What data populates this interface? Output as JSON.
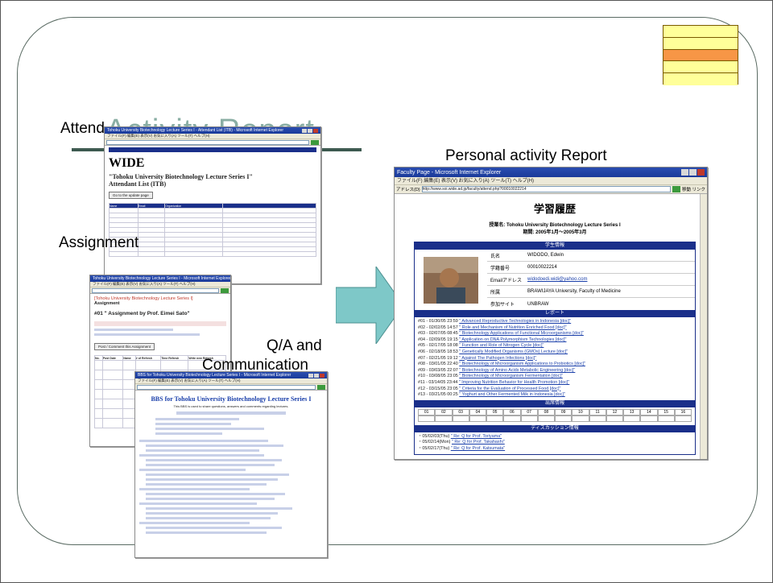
{
  "slide": {
    "title": "Activity Report",
    "labels": {
      "attend": "Attend",
      "assignment": "Assignment",
      "qa_line1": "Q/A and",
      "qa_line2": "Communication",
      "personal": "Personal activity Report"
    }
  },
  "colors": {
    "deco_yellow": "#ffff99",
    "deco_orange": "#f79646",
    "arrow": "#7ec8c8",
    "ie_title": "#1a3a9a"
  },
  "attend_window": {
    "titlebar": "Tohoku University Biotechnology Lecture Series I - Attendant List (ITB) - Microsoft Internet Explorer",
    "menubar": "ファイル(F)  編集(E)  表示(V)  お気に入り(A)  ツール(T)  ヘルプ(H)",
    "logo": "WIDE",
    "heading_line1": "\"Tohoku University Biotechnology Lecture Series I\"",
    "heading_line2": "Attendant List (ITB)",
    "update_button": "Go to the update page",
    "col_headers": [
      "Name",
      "Email",
      "Organization"
    ]
  },
  "assignment_window": {
    "titlebar": "Tohoku University Biotechnology Lecture Series I - Microsoft Internet Explorer",
    "heading": "[Tohoku University Biotechnology Lecture Series I]",
    "subheading": "Assignment",
    "assignment_title": "#01 \" Assignment by Prof. Eimei Sato\"",
    "post_button": "Post / Comment this Assignment",
    "col_headers": [
      "No.",
      "Post Date",
      "Name",
      "# of Refresh",
      "Time Refresh",
      "Write new Refresh"
    ]
  },
  "bbs_window": {
    "titlebar": "BBS for Tohoku University Biotechnology Lecture Series I - Microsoft Internet Explorer",
    "heading": "BBS for Tohoku University Biotechnology Lecture Series I",
    "subline": "This BBS is used to share questions, answers and comments regarding lectures."
  },
  "personal_window": {
    "titlebar": "Faculty Page - Microsoft Internet Explorer",
    "menubar": "ファイル(F)  編集(E)  表示(V)  お気に入り(A)  ツール(T)  ヘルプ(H)",
    "address_label": "アドレス(D)",
    "address": "http://www.soi.wide.ad.jp/faculty/attend.php?00010022214",
    "links_label": "移動  リンク",
    "page_title": "学習履歴",
    "course_line1": "授業名: Tohoku University Biotechnology Lecture Series I",
    "course_line2": "期間: 2005年1月～2005年3月",
    "student_info_header": "学生情報",
    "fields": [
      {
        "key": "氏名",
        "value": "WIDODO, Edwin"
      },
      {
        "key": "学籍番号",
        "value": "00010022214"
      },
      {
        "key": "Emailアドレス",
        "value": "widodoedi.widi@yahoo.com"
      },
      {
        "key": "所属",
        "value": "BRAWIJAYA University, Faculty of Medicine"
      },
      {
        "key": "参加サイト",
        "value": "UNBRAW"
      }
    ],
    "report_header": "レポート",
    "reports": [
      {
        "no": "#01",
        "date": "01/30/05 23:59",
        "title": "\" Advanced Reproductive Technologies in Indonesia [doc]\""
      },
      {
        "no": "#02",
        "date": "02/02/05 14:57",
        "title": "\" Role and Mechanism of Nutrition Enriched Food [doc]\""
      },
      {
        "no": "#03",
        "date": "02/07/05 08:45",
        "title": "\" Biotechnology Applications of Functional Microorganisms [doc]\""
      },
      {
        "no": "#04",
        "date": "02/09/05 19:15",
        "title": "\" Application on DNA Polymorphism Technologies [doc]\""
      },
      {
        "no": "#05",
        "date": "02/17/05 18:08",
        "title": "\" Function and Role of Nitrogen Cycle [doc]\""
      },
      {
        "no": "#06",
        "date": "02/18/05 18:53",
        "title": "\" Genetically Modified Organisms (GMOs) Lecture [doc]\""
      },
      {
        "no": "#07",
        "date": "02/21/05 19:12",
        "title": "\" Against The Pathogen Infections [doc]\""
      },
      {
        "no": "#08",
        "date": "03/01/05 22:40",
        "title": "\" Biotechnology of Microorganism Applications to Probiotics [doc]\""
      },
      {
        "no": "#09",
        "date": "03/03/05 22:07",
        "title": "\" Biotechnology of Amino Acids Metabolic Engineering [doc]\""
      },
      {
        "no": "#10",
        "date": "03/08/05 23:05",
        "title": "\" Biotechnology of Microorganism Fermentation [doc]\""
      },
      {
        "no": "#11",
        "date": "03/14/05 23:44",
        "title": "\" Improving Nutrition Behavior for Health Promotion [doc]\""
      },
      {
        "no": "#12",
        "date": "03/15/05 23:05",
        "title": "\" Criteria for the Evaluation of Processed Food [doc]\""
      },
      {
        "no": "#13",
        "date": "03/21/05 00:25",
        "title": "\" Yoghurt and Other Fermented Milk in Indonesia [doc]\""
      }
    ],
    "attendance_header": "出席情報",
    "attendance_cols": [
      "01",
      "02",
      "03",
      "04",
      "05",
      "06",
      "07",
      "08",
      "09",
      "10",
      "11",
      "12",
      "13",
      "14",
      "15",
      "16"
    ],
    "discussion_header": "ディスカッション情報",
    "discussions": [
      {
        "date": "05/02/03(Thu)",
        "title": "\" Re: Q for Prof. Toriyama\""
      },
      {
        "date": "05/02/14(Mon)",
        "title": "\" Re: Q for Prof. Takahashi\""
      },
      {
        "date": "05/02/17(Thu)",
        "title": "\" Re: Q for Prof. Katsumata\""
      }
    ]
  }
}
